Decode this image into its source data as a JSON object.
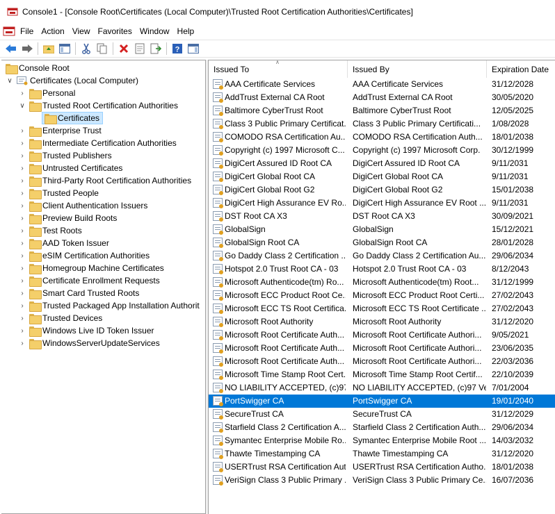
{
  "window": {
    "title": "Console1 - [Console Root\\Certificates (Local Computer)\\Trusted Root Certification Authorities\\Certificates]"
  },
  "menu": [
    "File",
    "Action",
    "View",
    "Favorites",
    "Window",
    "Help"
  ],
  "toolbar": {
    "icons": [
      "back-arrow-icon",
      "forward-arrow-icon",
      "up-folder-icon",
      "show-hide-tree-icon",
      "cut-icon",
      "copy-icon",
      "delete-icon",
      "properties-icon",
      "export-list-icon",
      "help-icon",
      "action-pane-icon"
    ]
  },
  "tree": {
    "root": "Console Root",
    "computer": "Certificates (Local Computer)",
    "trusted_root": "Trusted Root Certification Authorities",
    "certificates": "Certificates",
    "siblings_before": [
      "Personal"
    ],
    "siblings_after": [
      "Enterprise Trust",
      "Intermediate Certification Authorities",
      "Trusted Publishers",
      "Untrusted Certificates",
      "Third-Party Root Certification Authorities",
      "Trusted People",
      "Client Authentication Issuers",
      "Preview Build Roots",
      "Test Roots",
      "AAD Token Issuer",
      "eSIM Certification Authorities",
      "Homegroup Machine Certificates",
      "Certificate Enrollment Requests",
      "Smart Card Trusted Roots",
      "Trusted Packaged App Installation Authorit",
      "Trusted Devices",
      "Windows Live ID Token Issuer",
      "WindowsServerUpdateServices"
    ]
  },
  "columns": {
    "issued_to": "Issued To",
    "issued_by": "Issued By",
    "expiration": "Expiration Date"
  },
  "selected_index": 24,
  "rows": [
    {
      "to": "AAA Certificate Services",
      "by": "AAA Certificate Services",
      "exp": "31/12/2028"
    },
    {
      "to": "AddTrust External CA Root",
      "by": "AddTrust External CA Root",
      "exp": "30/05/2020"
    },
    {
      "to": "Baltimore CyberTrust Root",
      "by": "Baltimore CyberTrust Root",
      "exp": "12/05/2025"
    },
    {
      "to": "Class 3 Public Primary Certificat...",
      "by": "Class 3 Public Primary Certificati...",
      "exp": "1/08/2028"
    },
    {
      "to": "COMODO RSA Certification Au...",
      "by": "COMODO RSA Certification Auth...",
      "exp": "18/01/2038"
    },
    {
      "to": "Copyright (c) 1997 Microsoft C...",
      "by": "Copyright (c) 1997 Microsoft Corp.",
      "exp": "30/12/1999"
    },
    {
      "to": "DigiCert Assured ID Root CA",
      "by": "DigiCert Assured ID Root CA",
      "exp": "9/11/2031"
    },
    {
      "to": "DigiCert Global Root CA",
      "by": "DigiCert Global Root CA",
      "exp": "9/11/2031"
    },
    {
      "to": "DigiCert Global Root G2",
      "by": "DigiCert Global Root G2",
      "exp": "15/01/2038"
    },
    {
      "to": "DigiCert High Assurance EV Ro...",
      "by": "DigiCert High Assurance EV Root ...",
      "exp": "9/11/2031"
    },
    {
      "to": "DST Root CA X3",
      "by": "DST Root CA X3",
      "exp": "30/09/2021"
    },
    {
      "to": "GlobalSign",
      "by": "GlobalSign",
      "exp": "15/12/2021"
    },
    {
      "to": "GlobalSign Root CA",
      "by": "GlobalSign Root CA",
      "exp": "28/01/2028"
    },
    {
      "to": "Go Daddy Class 2 Certification ...",
      "by": "Go Daddy Class 2 Certification Au...",
      "exp": "29/06/2034"
    },
    {
      "to": "Hotspot 2.0 Trust Root CA - 03",
      "by": "Hotspot 2.0 Trust Root CA - 03",
      "exp": "8/12/2043"
    },
    {
      "to": "Microsoft Authenticode(tm) Ro...",
      "by": "Microsoft Authenticode(tm) Root...",
      "exp": "31/12/1999"
    },
    {
      "to": "Microsoft ECC Product Root Ce...",
      "by": "Microsoft ECC Product Root Certi...",
      "exp": "27/02/2043"
    },
    {
      "to": "Microsoft ECC TS Root Certifica...",
      "by": "Microsoft ECC TS Root Certificate ...",
      "exp": "27/02/2043"
    },
    {
      "to": "Microsoft Root Authority",
      "by": "Microsoft Root Authority",
      "exp": "31/12/2020"
    },
    {
      "to": "Microsoft Root Certificate Auth...",
      "by": "Microsoft Root Certificate Authori...",
      "exp": "9/05/2021"
    },
    {
      "to": "Microsoft Root Certificate Auth...",
      "by": "Microsoft Root Certificate Authori...",
      "exp": "23/06/2035"
    },
    {
      "to": "Microsoft Root Certificate Auth...",
      "by": "Microsoft Root Certificate Authori...",
      "exp": "22/03/2036"
    },
    {
      "to": "Microsoft Time Stamp Root Cert...",
      "by": "Microsoft Time Stamp Root Certif...",
      "exp": "22/10/2039"
    },
    {
      "to": "NO LIABILITY ACCEPTED, (c)97 ...",
      "by": "NO LIABILITY ACCEPTED, (c)97 Ve...",
      "exp": "7/01/2004"
    },
    {
      "to": "PortSwigger CA",
      "by": "PortSwigger CA",
      "exp": "19/01/2040"
    },
    {
      "to": "SecureTrust CA",
      "by": "SecureTrust CA",
      "exp": "31/12/2029"
    },
    {
      "to": "Starfield Class 2 Certification A...",
      "by": "Starfield Class 2 Certification Auth...",
      "exp": "29/06/2034"
    },
    {
      "to": "Symantec Enterprise Mobile Ro...",
      "by": "Symantec Enterprise Mobile Root ...",
      "exp": "14/03/2032"
    },
    {
      "to": "Thawte Timestamping CA",
      "by": "Thawte Timestamping CA",
      "exp": "31/12/2020"
    },
    {
      "to": "USERTrust RSA Certification Aut...",
      "by": "USERTrust RSA Certification Autho...",
      "exp": "18/01/2038"
    },
    {
      "to": "VeriSign Class 3 Public Primary ...",
      "by": "VeriSign Class 3 Public Primary Ce...",
      "exp": "16/07/2036"
    }
  ],
  "colors": {
    "selection": "#0078d7",
    "folder": "#f4cf6a"
  }
}
